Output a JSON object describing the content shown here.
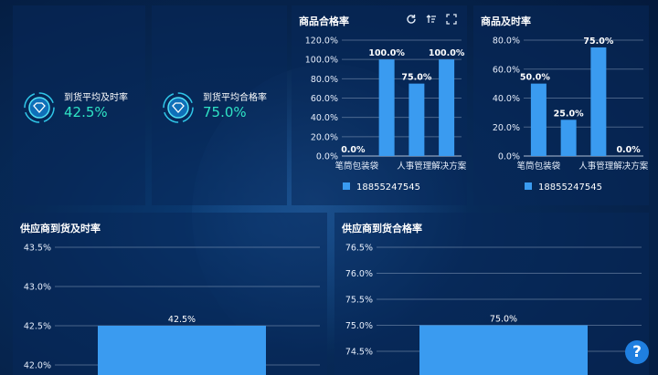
{
  "kpis": [
    {
      "label": "到货平均及时率",
      "value": "42.5%"
    },
    {
      "label": "到货平均合格率",
      "value": "75.0%"
    }
  ],
  "colors": {
    "bar": "#3a9bf0",
    "kpi_value": "#2fe4c5",
    "axis_text": "#e6eefb"
  },
  "charts": {
    "quality": {
      "title": "商品合格率",
      "legend": "18855247545"
    },
    "timeliness": {
      "title": "商品及时率",
      "legend": "18855247545"
    },
    "supplier_timeliness": {
      "title": "供应商到货及时率"
    },
    "supplier_quality": {
      "title": "供应商到货合格率"
    }
  },
  "icons": [
    "refresh-icon",
    "sort-icon",
    "fullscreen-icon",
    "help-icon"
  ],
  "help_label": "?",
  "chart_data": [
    {
      "id": "quality",
      "type": "bar",
      "title": "商品合格率",
      "categories": [
        "笔筒包装袋",
        "",
        "人事管理解决方案",
        ""
      ],
      "tick_labels_shown": [
        "笔筒包装袋",
        "人事管理解决方案"
      ],
      "series": [
        {
          "name": "18855247545",
          "values": [
            0,
            100,
            75,
            100
          ]
        }
      ],
      "data_labels": [
        "0.0%",
        "100.0%",
        "75.0%",
        "100.0%"
      ],
      "ylim": [
        0,
        120
      ],
      "yticks": [
        "0.0%",
        "20.0%",
        "40.0%",
        "60.0%",
        "80.0%",
        "100.0%",
        "120.0%"
      ],
      "legend": "bottom",
      "grid": true
    },
    {
      "id": "timeliness",
      "type": "bar",
      "title": "商品及时率",
      "categories": [
        "笔筒包装袋",
        "",
        "人事管理解决方案",
        ""
      ],
      "tick_labels_shown": [
        "笔筒包装袋",
        "人事管理解决方案"
      ],
      "series": [
        {
          "name": "18855247545",
          "values": [
            50,
            25,
            75,
            0
          ]
        }
      ],
      "data_labels": [
        "50.0%",
        "25.0%",
        "75.0%",
        "0.0%"
      ],
      "ylim": [
        0,
        80
      ],
      "yticks": [
        "0.0%",
        "20.0%",
        "40.0%",
        "60.0%",
        "80.0%"
      ],
      "legend": "bottom",
      "grid": true
    },
    {
      "id": "supplier_timeliness",
      "type": "bar",
      "title": "供应商到货及时率",
      "categories": [
        ""
      ],
      "series": [
        {
          "values": [
            42.5
          ]
        }
      ],
      "data_labels": [
        "42.5%"
      ],
      "ylim_visible": [
        42.0,
        43.5
      ],
      "yticks": [
        "42.0%",
        "42.5%",
        "43.0%",
        "43.5%"
      ],
      "grid": true
    },
    {
      "id": "supplier_quality",
      "type": "bar",
      "title": "供应商到货合格率",
      "categories": [
        ""
      ],
      "series": [
        {
          "values": [
            75.0
          ]
        }
      ],
      "data_labels": [
        "75.0%"
      ],
      "ylim_visible": [
        74.5,
        76.5
      ],
      "yticks": [
        "74.5%",
        "75.0%",
        "75.5%",
        "76.0%",
        "76.5%"
      ],
      "grid": true
    }
  ]
}
